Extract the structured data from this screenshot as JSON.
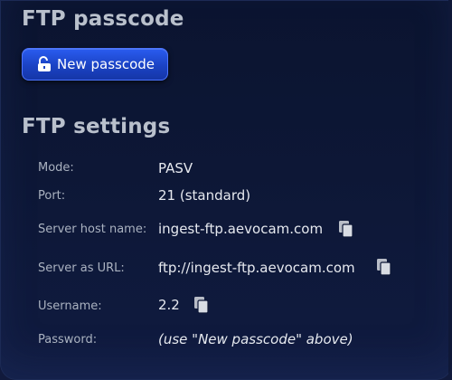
{
  "passcode_section": {
    "title": "FTP passcode",
    "new_button_label": "New passcode",
    "button_icon": "unlock-icon"
  },
  "settings_section": {
    "title": "FTP settings",
    "rows": [
      {
        "label": "Mode:",
        "value": "PASV",
        "copyable": false
      },
      {
        "label": "Port:",
        "value": "21 (standard)",
        "copyable": false
      },
      {
        "label": "Server host name:",
        "value": "ingest-ftp.aevocam.com",
        "copyable": true
      },
      {
        "label": "Server as URL:",
        "value": "ftp://ingest-ftp.aevocam.com",
        "copyable": true
      },
      {
        "label": "Username:",
        "value": "2.2",
        "copyable": true
      },
      {
        "label": "Password:",
        "value": "(use \"New passcode\" above)",
        "copyable": false
      }
    ],
    "copy_icon": "copy-icon"
  },
  "colors": {
    "background": "#0d1736",
    "heading": "#b9c0cc",
    "label": "#aab2c0",
    "value": "#e6e9ef",
    "accent_button": "#1f4bd6"
  }
}
